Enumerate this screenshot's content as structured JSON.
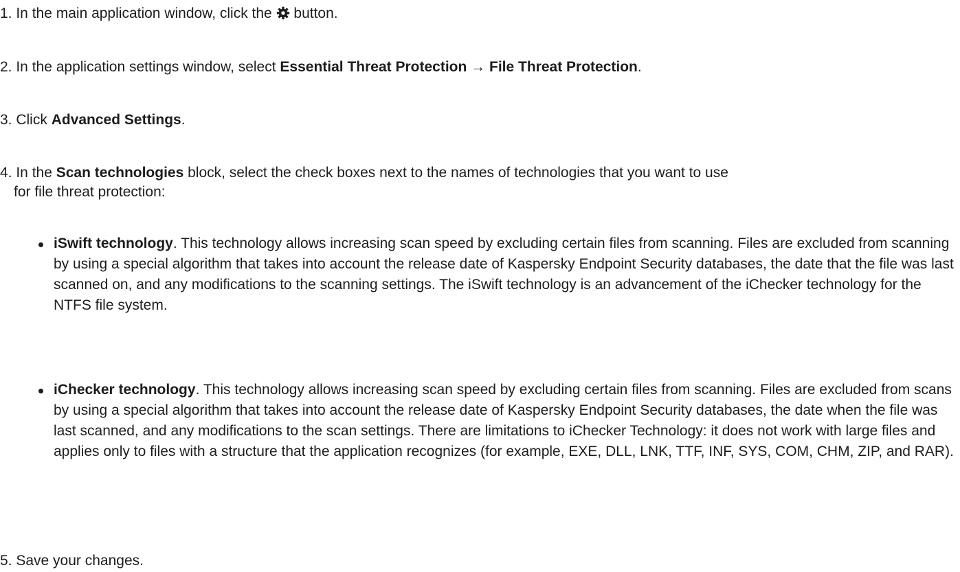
{
  "steps": [
    {
      "num": "1.",
      "pre": " In the main application window, click the ",
      "icon": "gear-icon",
      "post": " button."
    },
    {
      "num": "2.",
      "pre": " In the application settings window, select ",
      "bold1": "Essential Threat Protection",
      "arrow": " → ",
      "bold2": "File Threat Protection",
      "post": "."
    },
    {
      "num": "3.",
      "pre": " Click ",
      "bold1": "Advanced Settings",
      "post": "."
    },
    {
      "num": "4.",
      "pre": " In the ",
      "bold1": "Scan technologies",
      "post": " block, select the check boxes next to the names of technologies that you want to use",
      "cont": "for file threat protection:"
    },
    {
      "num": "5.",
      "text": " Save your changes."
    }
  ],
  "bullets": [
    {
      "title": "iSwift technology",
      "text": ". This technology allows increasing scan speed by excluding certain files from scanning. Files are excluded from scanning by using a special algorithm that takes into account the release date of Kaspersky Endpoint Security databases, the date that the file was last scanned on, and any modifications to the scanning settings. The iSwift technology is an advancement of the iChecker technology for the NTFS file system."
    },
    {
      "title": "iChecker technology",
      "text": ". This technology allows increasing scan speed by excluding certain files from scanning. Files are excluded from scans by using a special algorithm that takes into account the release date of Kaspersky Endpoint Security databases, the date when the file was last scanned, and any modifications to the scan settings. There are limitations to iChecker Technology: it does not work with large files and applies only to files with a structure that the application recognizes (for example, EXE, DLL, LNK, TTF, INF, SYS, COM, CHM, ZIP, and RAR)."
    }
  ]
}
